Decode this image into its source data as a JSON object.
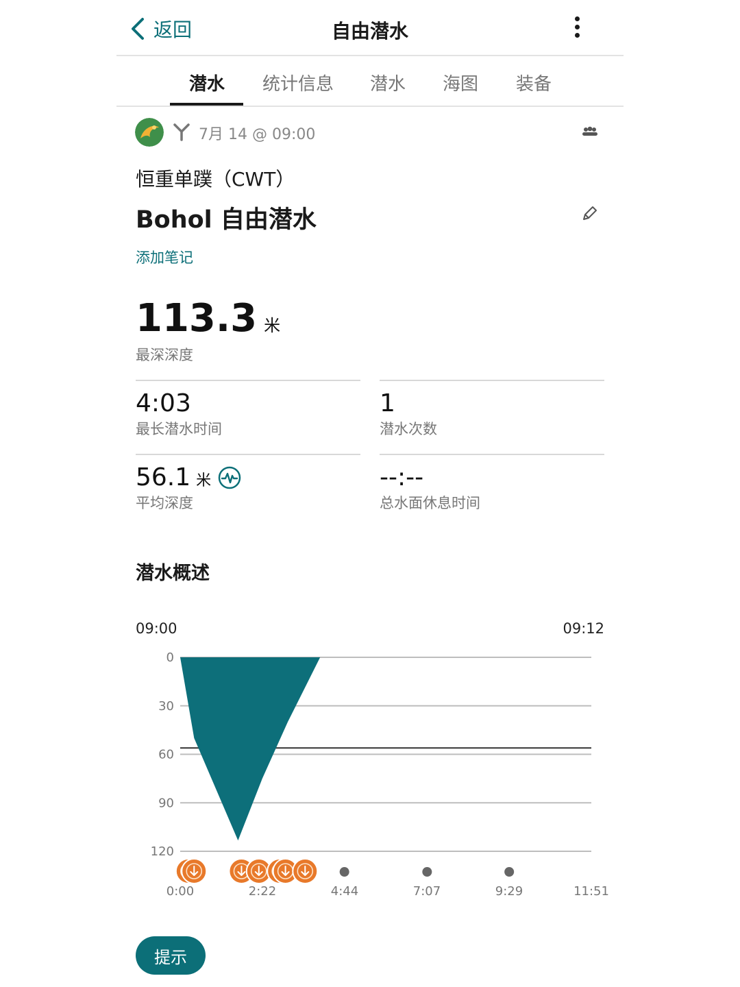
{
  "header": {
    "back_label": "返回",
    "title": "自由潜水"
  },
  "tabs": [
    {
      "label": "潜水",
      "active": true
    },
    {
      "label": "统计信息",
      "active": false
    },
    {
      "label": "潜水",
      "active": false
    },
    {
      "label": "海图",
      "active": false
    },
    {
      "label": "装备",
      "active": false
    }
  ],
  "activity": {
    "datetime": "7月 14 @ 09:00",
    "type": "恒重单蹼（CWT）",
    "name": "Bohol 自由潜水",
    "add_note": "添加笔记"
  },
  "stats": {
    "max_depth": {
      "value": "113.3",
      "unit": "米",
      "label": "最深深度"
    },
    "longest_dive": {
      "value": "4:03",
      "label": "最长潜水时间"
    },
    "dive_count": {
      "value": "1",
      "label": "潜水次数"
    },
    "avg_depth": {
      "value": "56.1",
      "unit": "米",
      "label": "平均深度"
    },
    "surface_time": {
      "value": "--:--",
      "label": "总水面休息时间"
    }
  },
  "section_title": "潜水概述",
  "chart_data": {
    "type": "area",
    "start_time": "09:00",
    "end_time": "09:12",
    "y_ticks": [
      0,
      30,
      60,
      90,
      120
    ],
    "x_ticks": [
      "0:00",
      "2:22",
      "4:44",
      "7:07",
      "9:29",
      "11:51"
    ],
    "ylim": [
      0,
      120
    ],
    "xlim_seconds": [
      0,
      711
    ],
    "reference_depth": 56.1,
    "depth_profile_seconds": [
      0,
      24,
      100,
      142,
      186,
      242
    ],
    "depth_profile_values": [
      0,
      50,
      113.3,
      75,
      40,
      0
    ],
    "color": "#0d6f7a",
    "event_marker_seconds": [
      14,
      24,
      106,
      136,
      172,
      182,
      216
    ],
    "dot_marker_seconds": [
      284,
      427,
      569
    ],
    "event_color": "#e8792a"
  },
  "hint_button": "提示",
  "colors": {
    "accent": "#0c6f78",
    "event": "#e8792a"
  }
}
